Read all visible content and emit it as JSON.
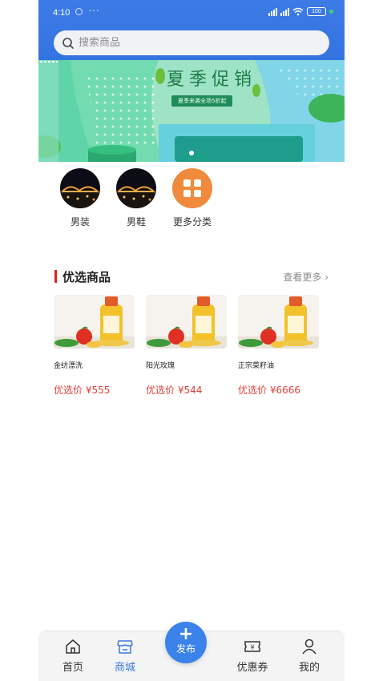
{
  "status_bar": {
    "time": "4:10",
    "more": "···",
    "battery": "100"
  },
  "search": {
    "placeholder": "搜索商品"
  },
  "banner": {
    "title": "夏季促销",
    "subtitle": "夏季来袭全场5折起"
  },
  "categories": [
    {
      "label": "男装",
      "icon": "night-city-photo"
    },
    {
      "label": "男鞋",
      "icon": "night-city-photo"
    },
    {
      "label": "更多分类",
      "icon": "grid-icon"
    }
  ],
  "section": {
    "title": "优选商品",
    "more": "查看更多 ›"
  },
  "products": [
    {
      "name": "金纺漂洗",
      "price": "优选价 ¥555"
    },
    {
      "name": "阳光玫瑰",
      "price": "优选价 ¥544"
    },
    {
      "name": "正宗菜籽油",
      "price": "优选价 ¥6666"
    }
  ],
  "tabbar": {
    "home": "首页",
    "mall": "商城",
    "publish": "发布",
    "coupon": "优惠券",
    "mine": "我的"
  },
  "colors": {
    "primary": "#3b78e3",
    "price": "#e0413a",
    "accent_red": "#d9241f",
    "orange": "#f08a3c"
  }
}
